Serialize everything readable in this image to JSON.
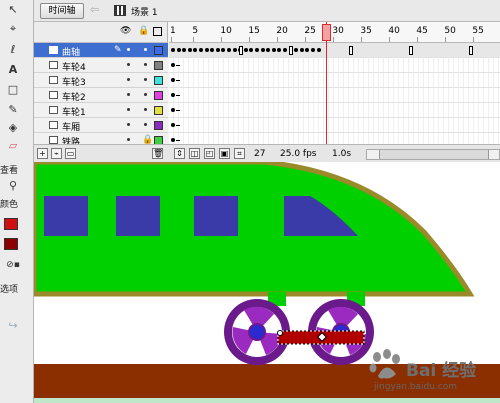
{
  "toolbar": {
    "timeline_button": "时间轴",
    "scene_label": "场景 1"
  },
  "tools": {
    "view_label": "查看",
    "color_label": "颜色",
    "options_label": "选项",
    "items": [
      "selection-tool",
      "subselection-tool",
      "lasso-tool",
      "text-tool",
      "rectangle-tool",
      "brush-tool",
      "paint-bucket-tool",
      "eraser-tool",
      "zoom-tool"
    ],
    "stroke_color": "#d01010",
    "fill_color": "#8b0000"
  },
  "layers": [
    {
      "name": "曲轴",
      "color": "#3e6fd0",
      "selected": true,
      "outline_color": "#3b6cf0"
    },
    {
      "name": "车轮4",
      "color": "#808080"
    },
    {
      "name": "车轮3",
      "color": "#3fe0e0"
    },
    {
      "name": "车轮2",
      "color": "#e040e0"
    },
    {
      "name": "车轮1",
      "color": "#e0e040"
    },
    {
      "name": "车厢",
      "color": "#8a2bc0"
    },
    {
      "name": "铁路",
      "color": "#3fd03f"
    }
  ],
  "ruler": {
    "labels": [
      "1",
      "5",
      "10",
      "15",
      "20",
      "25",
      "30",
      "35",
      "40",
      "45",
      "50",
      "55"
    ]
  },
  "status": {
    "frame": "27",
    "fps": "25.0 fps",
    "time": "1.0s"
  },
  "watermark": {
    "title": "Bai 经验",
    "url": "jingyan.baidu.com"
  },
  "colors": {
    "train_body": "#00d000",
    "train_outline": "#9a8a2a",
    "windows": "#3a3aa8",
    "wheel_outer": "#6a1a8a",
    "wheel_inner": "#9a2ac0",
    "hub": "#2a2ad0",
    "rail": "#8b2e00",
    "crank": "#b00000"
  }
}
